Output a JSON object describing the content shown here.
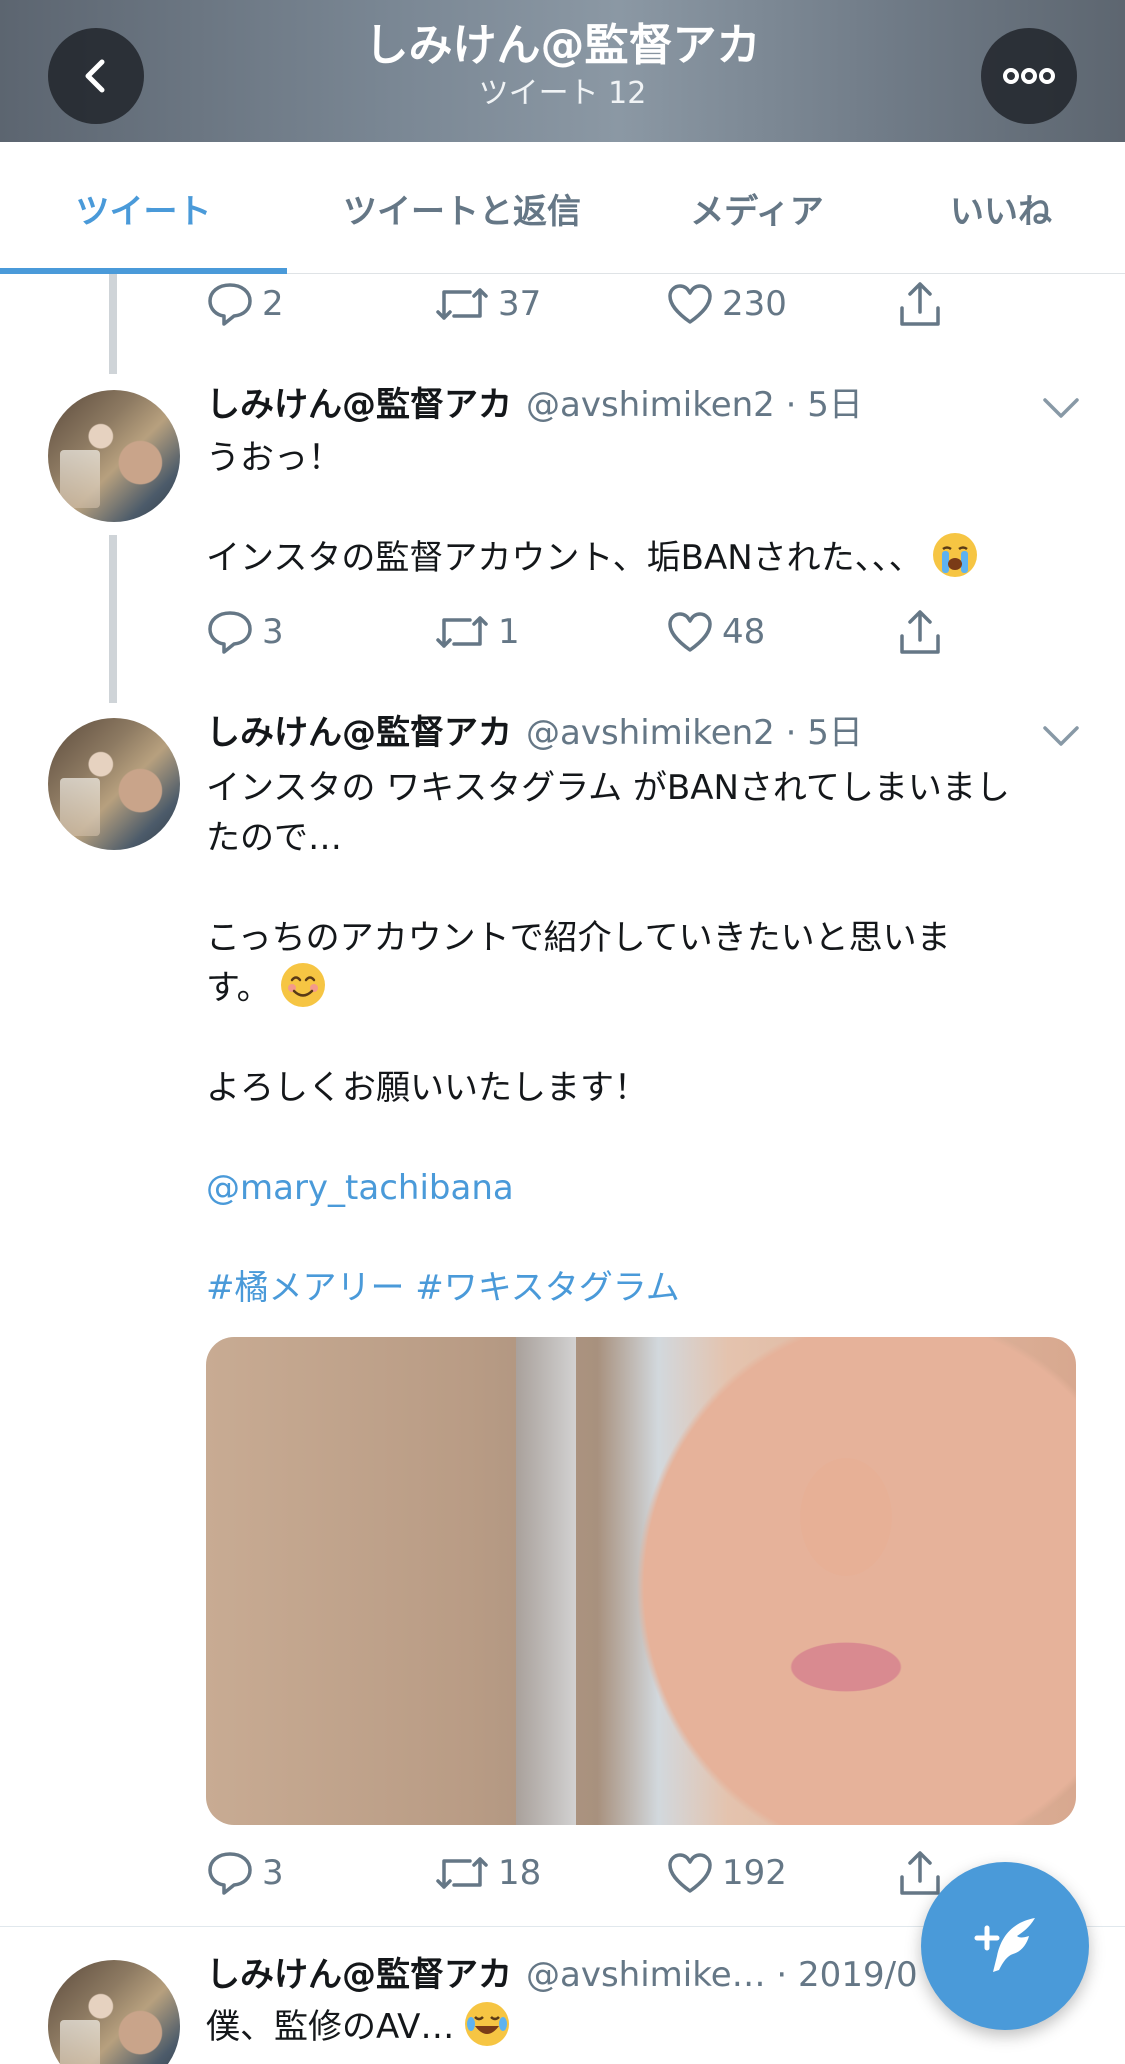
{
  "header": {
    "title": "しみけん@監督アカ",
    "subtitle": "ツイート 12"
  },
  "tabs": [
    {
      "label": "ツイート",
      "active": true
    },
    {
      "label": "ツイートと返信",
      "active": false
    },
    {
      "label": "メディア",
      "active": false
    },
    {
      "label": "いいね",
      "active": false
    }
  ],
  "colors": {
    "accent": "#4a9ad9",
    "muted": "#657786"
  },
  "tweets": [
    {
      "actions": {
        "replies": "2",
        "retweets": "37",
        "likes": "230"
      }
    },
    {
      "name": "しみけん@監督アカ",
      "meta": "@avshimiken2 · 5日",
      "text_lines": [
        "うおっ！",
        "",
        "インスタの監督アカウント、垢BANされた、、、"
      ],
      "emoji": "loudly-crying-face",
      "actions": {
        "replies": "3",
        "retweets": "1",
        "likes": "48"
      }
    },
    {
      "name": "しみけん@監督アカ",
      "meta": "@avshimiken2 · 5日",
      "line1": "インスタの ワキスタグラム がBANされてしまいまし",
      "line2": "たので…",
      "line3": "こっちのアカウントで紹介していきたいと思いま",
      "line4": "す。",
      "emoji": "smiling-face",
      "line5": "よろしくお願いいたします！",
      "mention": "@mary_tachibana",
      "hashtags": "#橘メアリー #ワキスタグラム",
      "actions": {
        "replies": "3",
        "retweets": "18",
        "likes": "192"
      }
    },
    {
      "name": "しみけん@監督アカ",
      "meta": "@avshimike… · 2019/0",
      "text": "僕、監修のAV…",
      "emoji": "face-with-tears-of-joy"
    }
  ],
  "icons": [
    "back-icon",
    "more-icon",
    "reply-icon",
    "retweet-icon",
    "like-icon",
    "share-icon",
    "chevron-down-icon",
    "compose-icon"
  ]
}
